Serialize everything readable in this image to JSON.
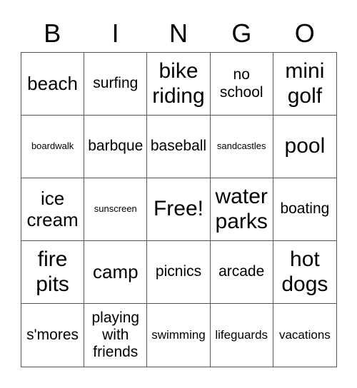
{
  "header": [
    "B",
    "I",
    "N",
    "G",
    "O"
  ],
  "cells": [
    {
      "text": "beach",
      "size": "l"
    },
    {
      "text": "surfing",
      "size": "m"
    },
    {
      "text": "bike riding",
      "size": "xl"
    },
    {
      "text": "no school",
      "size": "m"
    },
    {
      "text": "mini golf",
      "size": "xl"
    },
    {
      "text": "boardwalk",
      "size": "xs"
    },
    {
      "text": "barbque",
      "size": "m"
    },
    {
      "text": "baseball",
      "size": "m"
    },
    {
      "text": "sandcastles",
      "size": "xs"
    },
    {
      "text": "pool",
      "size": "xl"
    },
    {
      "text": "ice cream",
      "size": "l"
    },
    {
      "text": "sunscreen",
      "size": "xs"
    },
    {
      "text": "Free!",
      "size": "xl"
    },
    {
      "text": "water parks",
      "size": "xl"
    },
    {
      "text": "boating",
      "size": "m"
    },
    {
      "text": "fire pits",
      "size": "xl"
    },
    {
      "text": "camp",
      "size": "l"
    },
    {
      "text": "picnics",
      "size": "m"
    },
    {
      "text": "arcade",
      "size": "m"
    },
    {
      "text": "hot dogs",
      "size": "xl"
    },
    {
      "text": "s'mores",
      "size": "m"
    },
    {
      "text": "playing with friends",
      "size": "m"
    },
    {
      "text": "swimming",
      "size": "s"
    },
    {
      "text": "lifeguards",
      "size": "s"
    },
    {
      "text": "vacations",
      "size": "s"
    }
  ]
}
